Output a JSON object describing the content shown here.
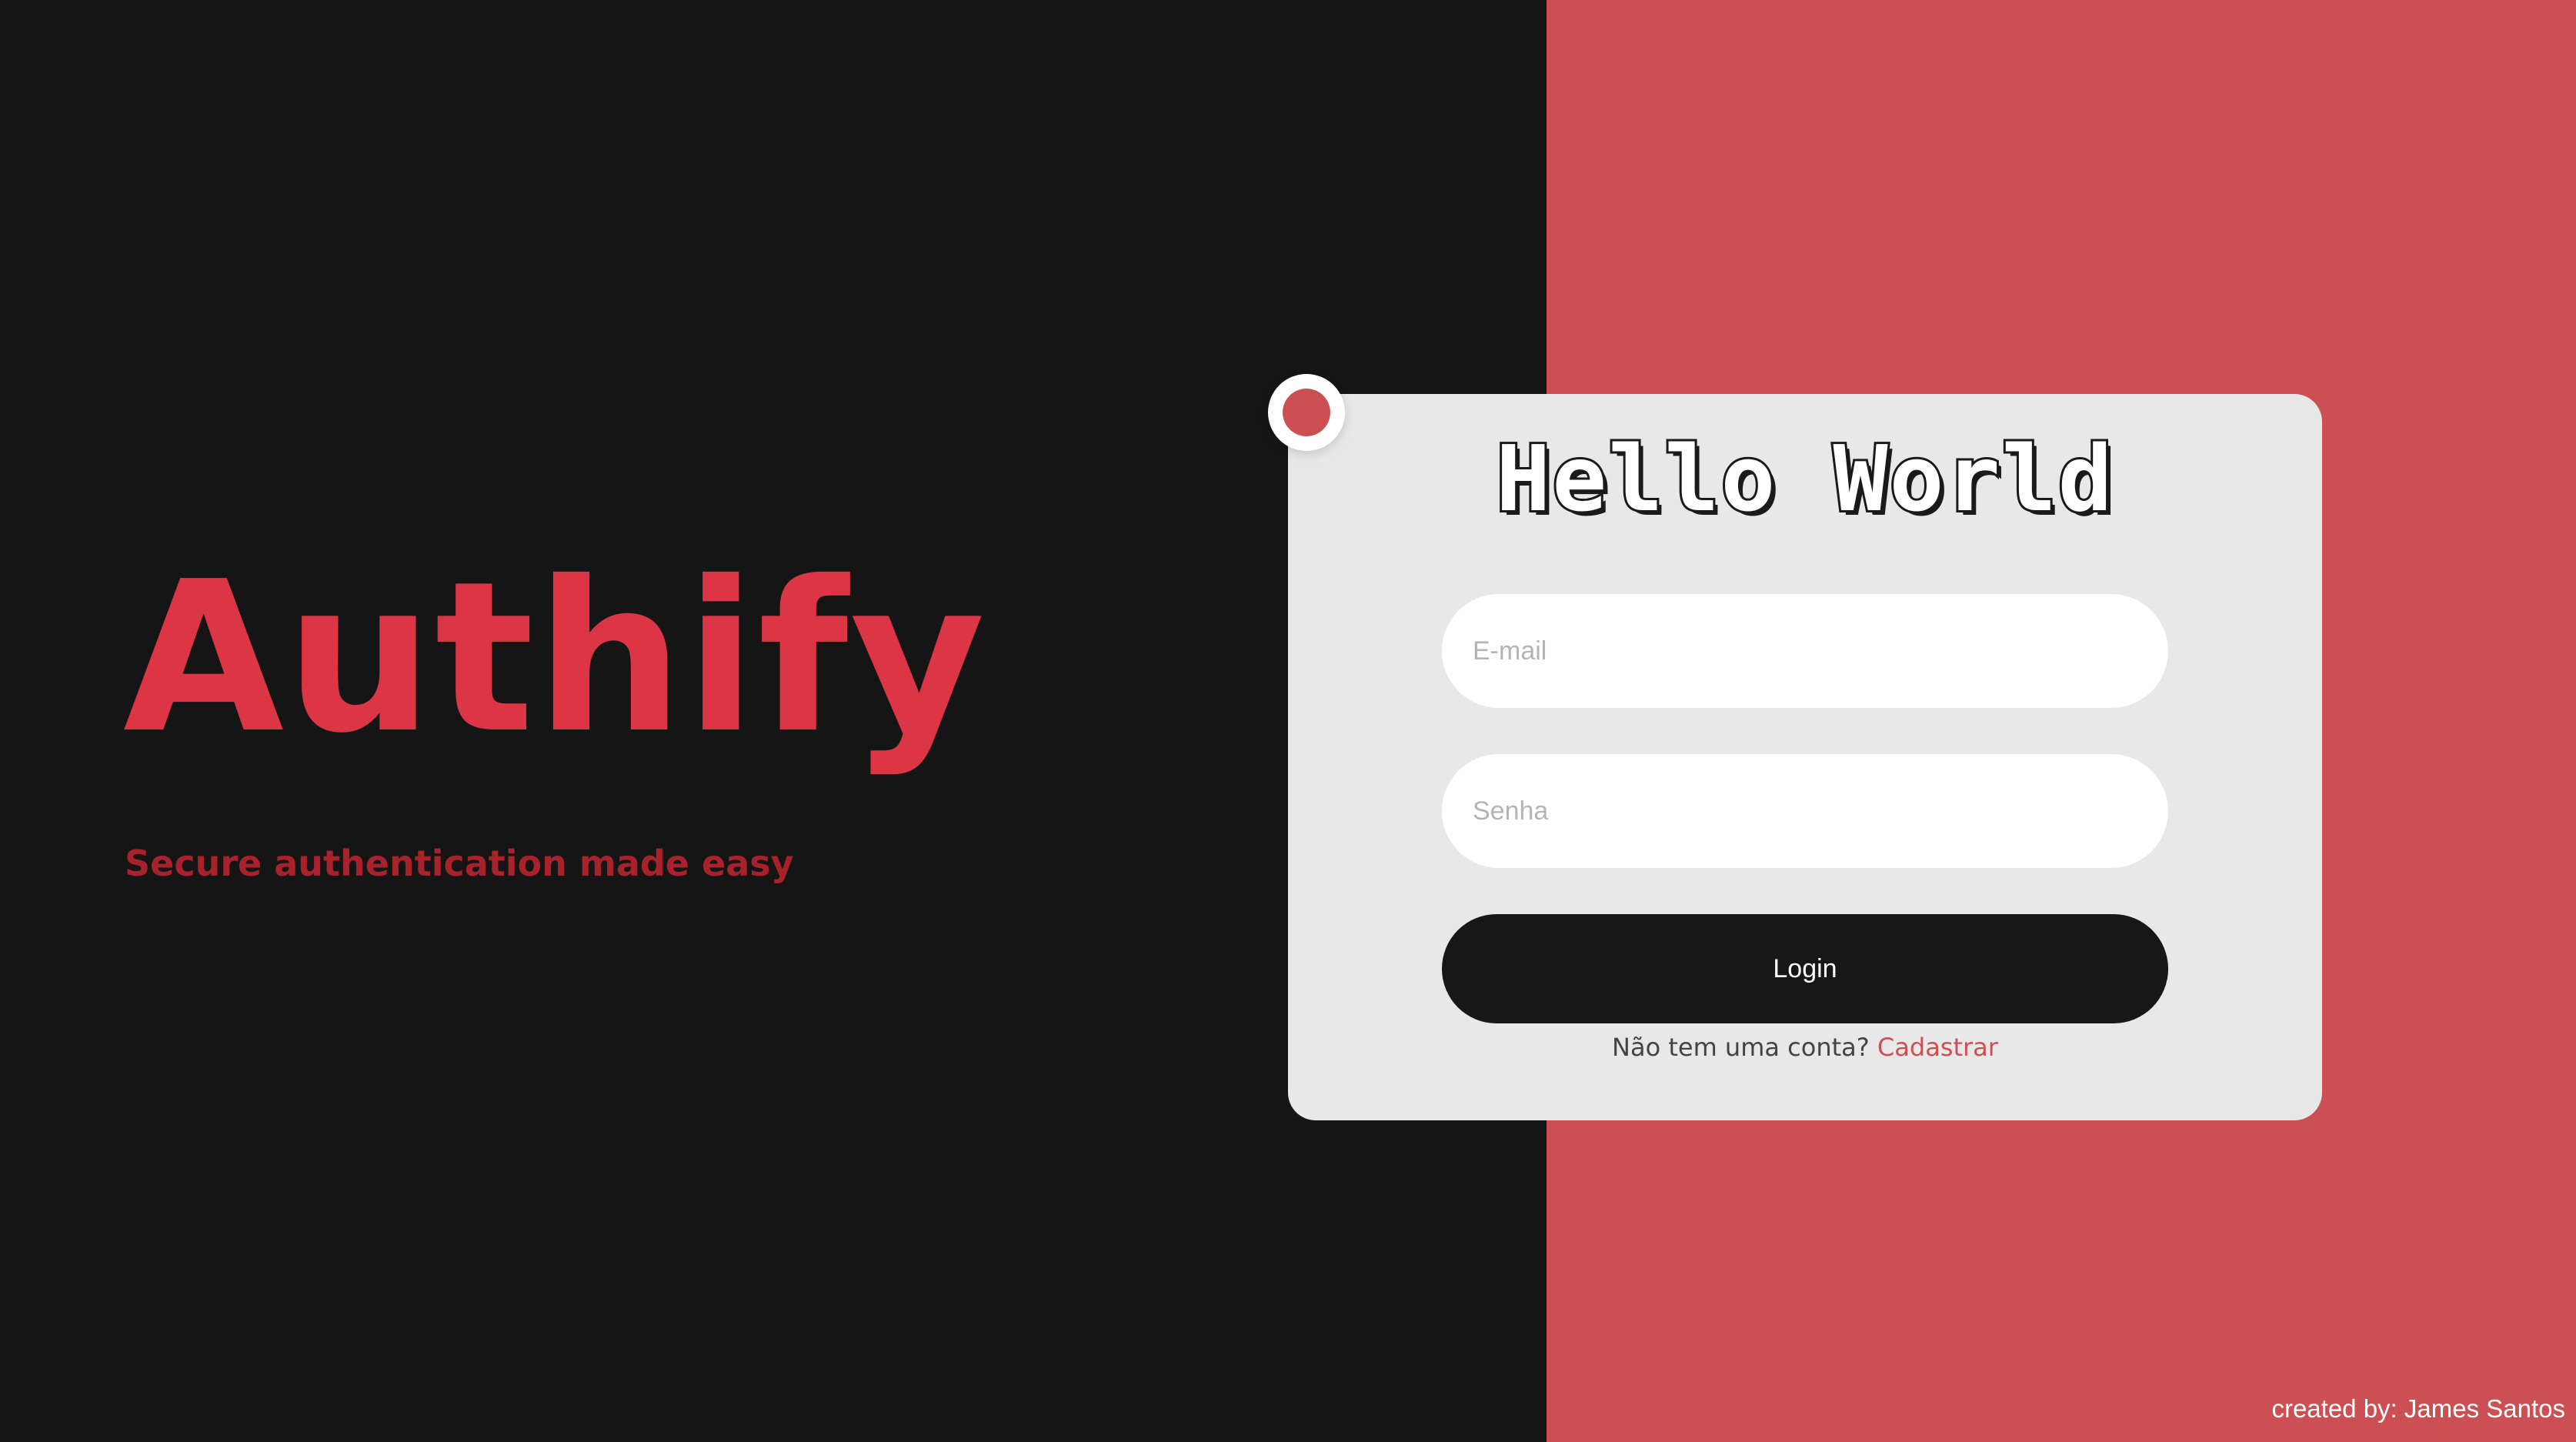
{
  "brand": {
    "name": "Authify",
    "tagline": "Secure authentication made easy"
  },
  "login_card": {
    "title": "Hello World",
    "email_placeholder": "E-mail",
    "password_placeholder": "Senha",
    "login_label": "Login",
    "signup_prompt": "Não tem uma conta?",
    "signup_link": "Cadastrar"
  },
  "footer": {
    "credits": "created by: James Santos"
  },
  "colors": {
    "dark_bg": "#151515",
    "accent_bg": "#cc5053",
    "brand_red": "#dc3545",
    "card_bg": "#e8e8e8"
  }
}
